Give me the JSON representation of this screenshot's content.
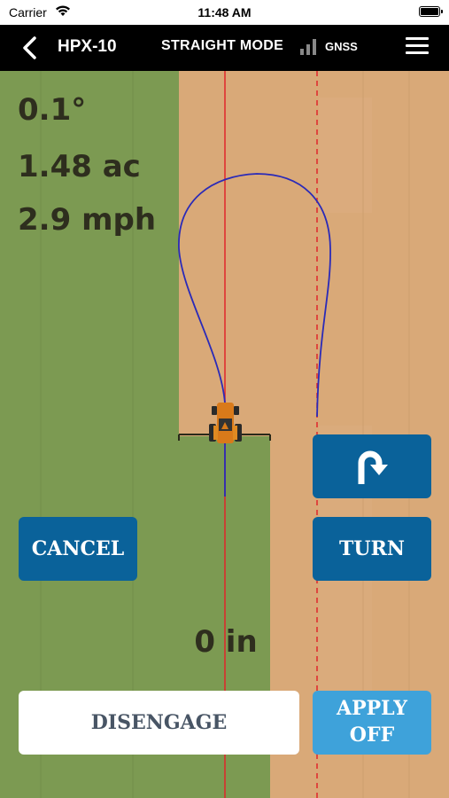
{
  "status_bar": {
    "carrier": "Carrier",
    "time": "11:48 AM"
  },
  "nav": {
    "title": "HPX-10",
    "mode": "STRAIGHT MODE",
    "gnss": "GNSS"
  },
  "readouts": {
    "heading": "0.1°",
    "area": "1.48 ac",
    "speed": "2.9 mph"
  },
  "offset": "0 in",
  "buttons": {
    "uturn_icon": "u-turn-arrow-icon",
    "cancel": "CANCEL",
    "turn": "TURN",
    "disengage": "DISENGAGE",
    "apply_line1": "APPLY",
    "apply_line2": "OFF"
  },
  "colors": {
    "field_bare": "#d9a978",
    "field_covered": "#7c9a52",
    "guidance_line": "#e0252b",
    "path": "#2a2ab8",
    "button_primary": "#0a629a",
    "button_apply": "#3ea2da"
  }
}
